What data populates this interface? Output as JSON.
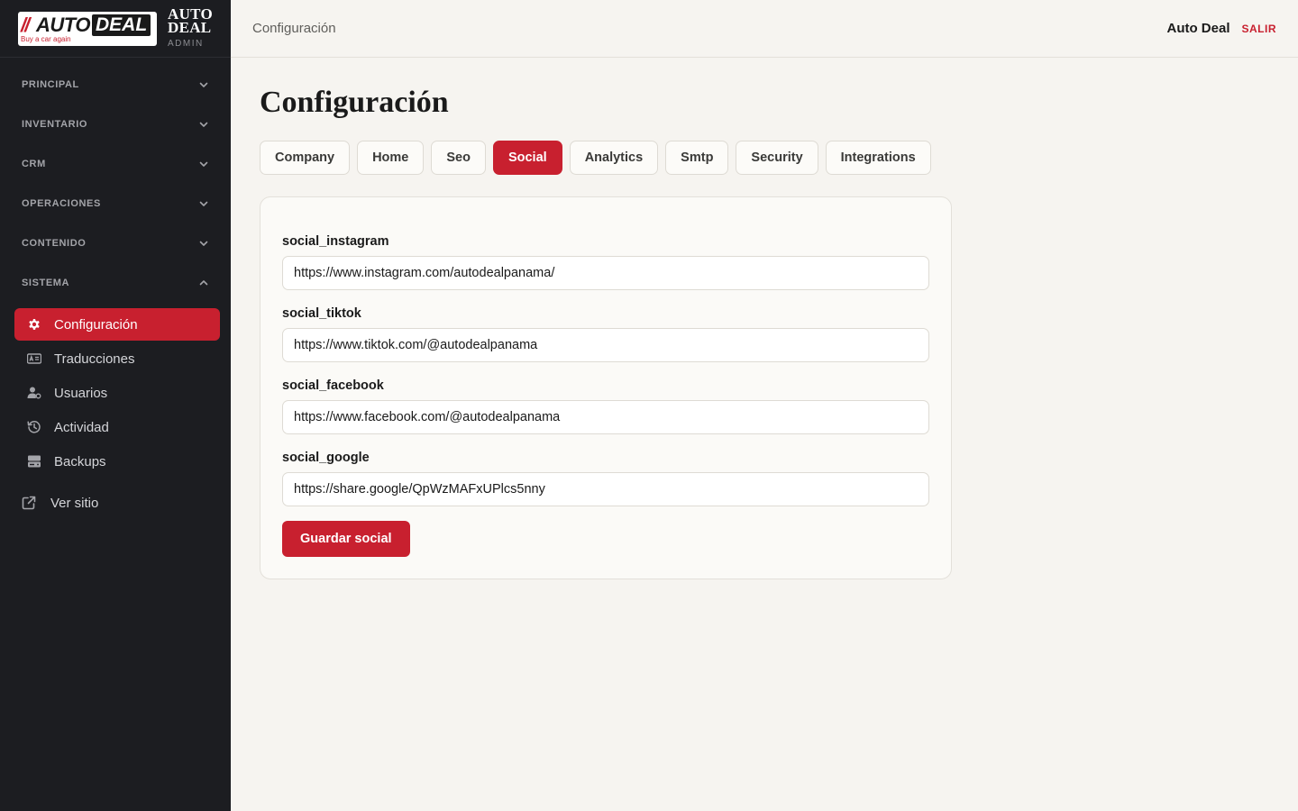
{
  "brand": {
    "logo_slash": "//",
    "logo_auto": "AUTO",
    "logo_deal": "DEAL",
    "logo_tagline": "Buy a car again",
    "title_line1": "AUTO",
    "title_line2": "DEAL",
    "subtitle": "ADMIN"
  },
  "sidebar": {
    "sections": [
      {
        "label": "PRINCIPAL",
        "expanded": false
      },
      {
        "label": "INVENTARIO",
        "expanded": false
      },
      {
        "label": "CRM",
        "expanded": false
      },
      {
        "label": "OPERACIONES",
        "expanded": false
      },
      {
        "label": "CONTENIDO",
        "expanded": false
      },
      {
        "label": "SISTEMA",
        "expanded": true
      }
    ],
    "system_items": [
      {
        "label": "Configuración",
        "icon": "gear-icon",
        "active": true
      },
      {
        "label": "Traducciones",
        "icon": "translate-icon",
        "active": false
      },
      {
        "label": "Usuarios",
        "icon": "users-icon",
        "active": false
      },
      {
        "label": "Actividad",
        "icon": "history-icon",
        "active": false
      },
      {
        "label": "Backups",
        "icon": "database-icon",
        "active": false
      }
    ],
    "view_site": "Ver sitio"
  },
  "topbar": {
    "breadcrumb": "Configuración",
    "user": "Auto Deal",
    "logout": "SALIR"
  },
  "page": {
    "title": "Configuración",
    "tabs": [
      {
        "label": "Company",
        "active": false
      },
      {
        "label": "Home",
        "active": false
      },
      {
        "label": "Seo",
        "active": false
      },
      {
        "label": "Social",
        "active": true
      },
      {
        "label": "Analytics",
        "active": false
      },
      {
        "label": "Smtp",
        "active": false
      },
      {
        "label": "Security",
        "active": false
      },
      {
        "label": "Integrations",
        "active": false
      }
    ],
    "form": {
      "fields": [
        {
          "label": "social_instagram",
          "value": "https://www.instagram.com/autodealpanama/"
        },
        {
          "label": "social_tiktok",
          "value": "https://www.tiktok.com/@autodealpanama"
        },
        {
          "label": "social_facebook",
          "value": "https://www.facebook.com/@autodealpanama"
        },
        {
          "label": "social_google",
          "value": "https://share.google/QpWzMAFxUPlcs5nny"
        }
      ],
      "submit_label": "Guardar social"
    }
  },
  "colors": {
    "accent": "#c8202f",
    "sidebar_bg": "#1c1d21",
    "page_bg": "#f6f4f0"
  }
}
